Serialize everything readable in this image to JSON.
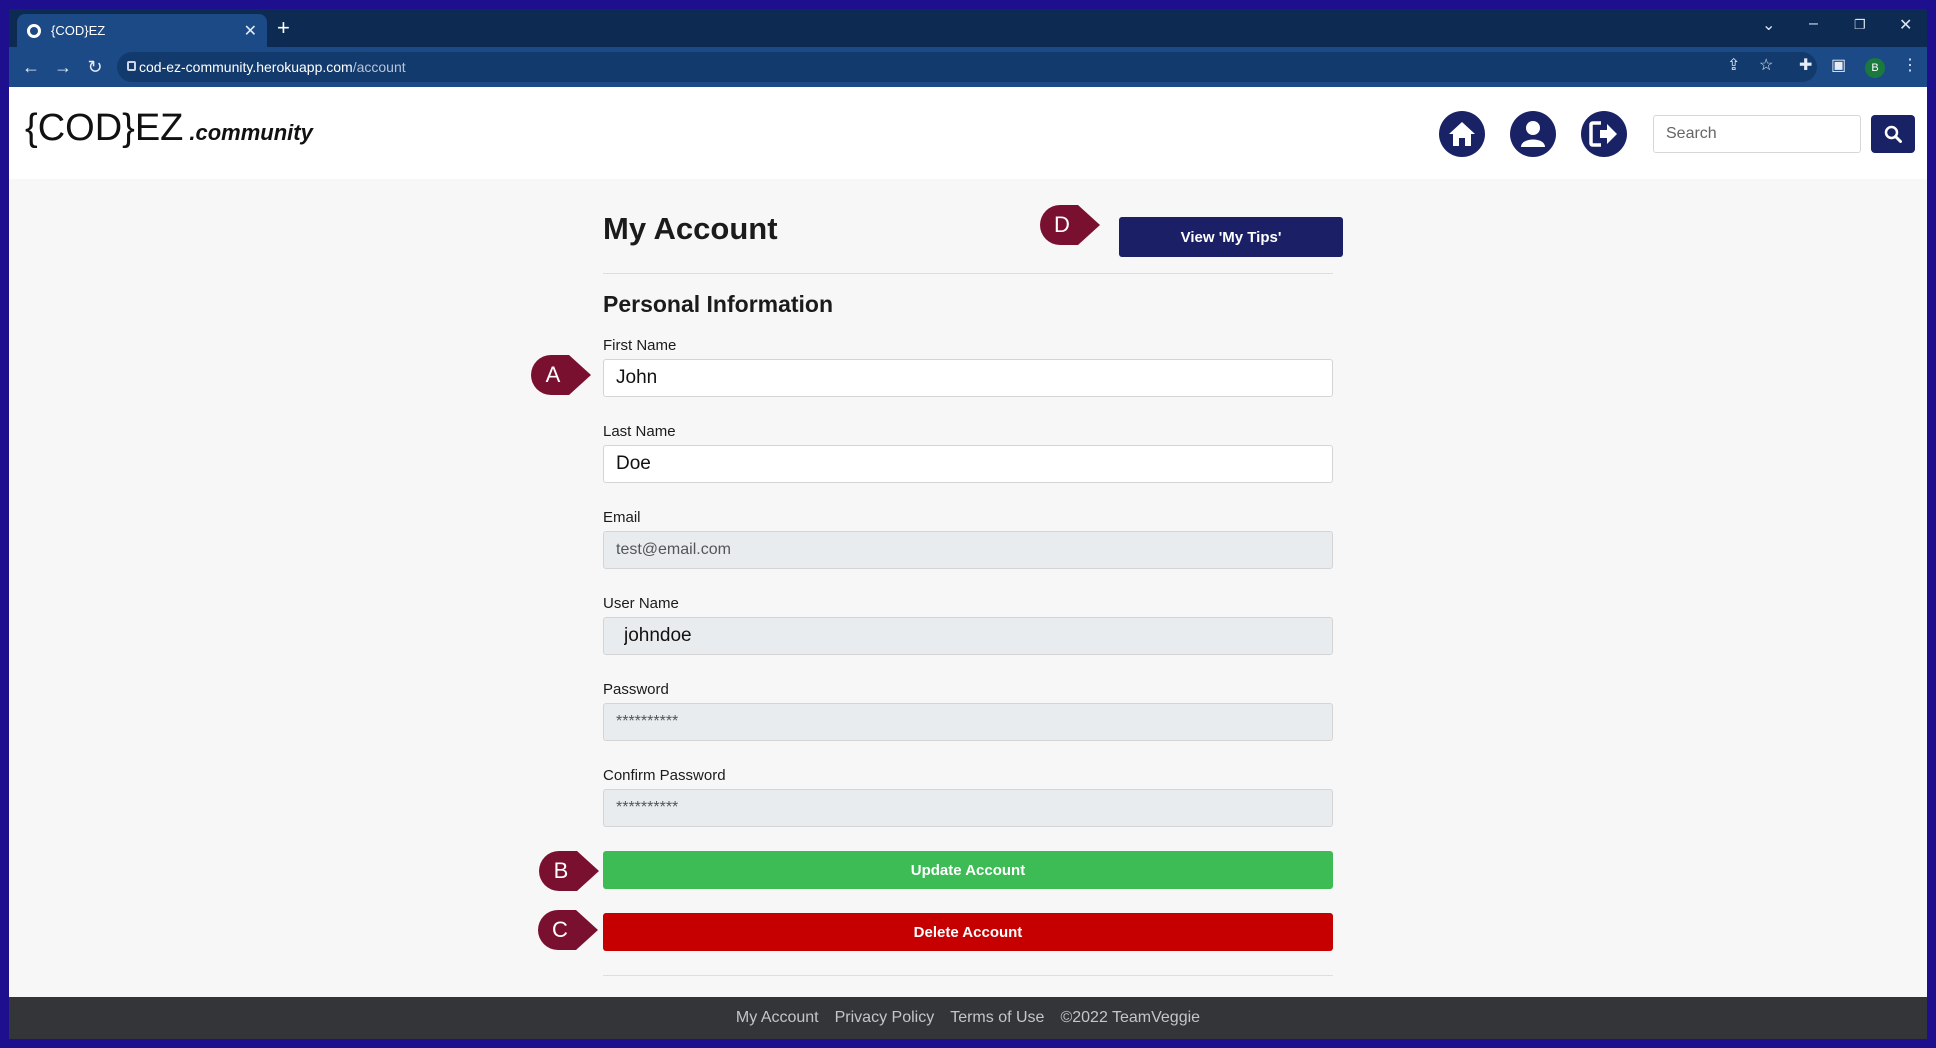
{
  "browser": {
    "tab_title": "{COD}EZ",
    "url_host": "cod-ez-community.herokuapp.com",
    "url_path": "/account",
    "profile_initial": "B"
  },
  "header": {
    "logo_main": "{COD}EZ",
    "logo_suffix": ".community",
    "search_placeholder": "Search",
    "icons": [
      "home-icon",
      "user-icon",
      "logout-icon",
      "search-icon"
    ]
  },
  "account": {
    "title": "My Account",
    "view_tips_label": "View 'My Tips'",
    "section_title": "Personal Information",
    "fields": [
      {
        "label": "First Name",
        "value": "John"
      },
      {
        "label": "Last Name",
        "value": "Doe"
      },
      {
        "label": "Email",
        "value": "test@email.com"
      },
      {
        "label": "User Name",
        "value": "johndoe"
      },
      {
        "label": "Password",
        "value": "**********"
      },
      {
        "label": "Confirm Password",
        "value": "**********"
      }
    ],
    "update_label": "Update Account",
    "delete_label": "Delete Account"
  },
  "markers": [
    "A",
    "B",
    "C",
    "D"
  ],
  "footer": {
    "links": [
      "My Account",
      "Privacy Policy",
      "Terms of Use"
    ],
    "copyright": "©2022 TeamVeggie"
  },
  "colors": {
    "primary": "#1a2266",
    "update": "#3dbb55",
    "delete": "#c60000",
    "marker": "#7a1030"
  }
}
